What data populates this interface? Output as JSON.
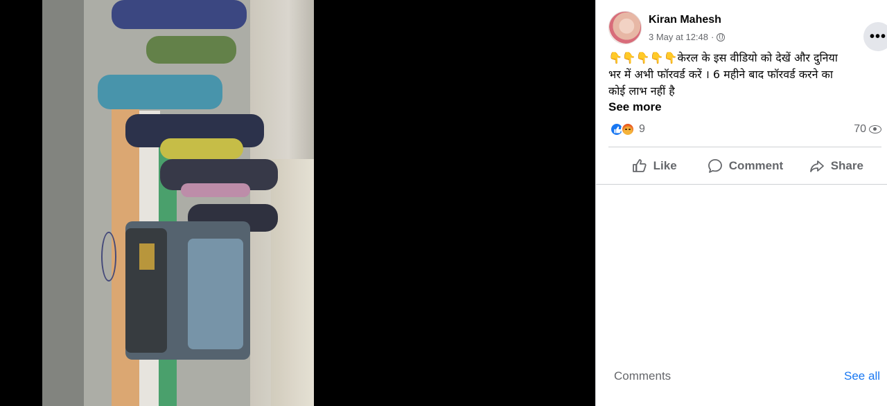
{
  "post": {
    "author": "Kiran Mahesh",
    "timestamp": "3 May at 12:48",
    "separator": "·",
    "visibility_icon": "globe-icon",
    "more_label": "•••",
    "text_line1": "👇👇👇👇👇केरल के इस वीडियो को देखें और दुनिया",
    "text_line2": "भर में अभी फॉरवर्ड करें । 6 महीने बाद फॉरवर्ड करने का",
    "text_line3": "कोई लाभ नहीं है",
    "see_more": "See more",
    "reaction_count": "9",
    "reaction_icons": [
      "like-reaction-icon",
      "angry-reaction-icon"
    ],
    "views_count": "70",
    "views_icon": "eye-icon"
  },
  "actions": {
    "like": "Like",
    "comment": "Comment",
    "share": "Share"
  },
  "comments": {
    "label": "Comments",
    "see_all": "See all"
  },
  "colors": {
    "accent": "#1877f2",
    "secondary_text": "#65676b",
    "primary_text": "#050505",
    "divider": "#ced0d4"
  }
}
